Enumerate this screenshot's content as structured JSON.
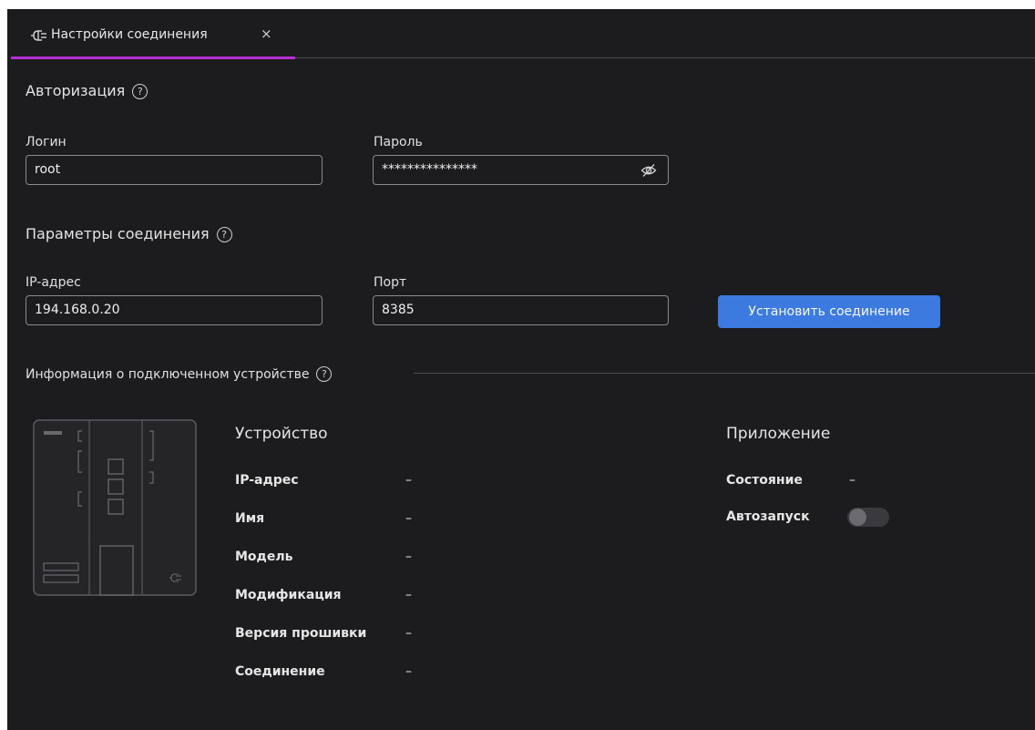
{
  "tab": {
    "icon": "plug-icon",
    "label": "Настройки соединения",
    "close_icon": "close-icon",
    "close_glyph": "×"
  },
  "auth": {
    "title": "Авторизация",
    "login_label": "Логин",
    "login_value": "root",
    "password_label": "Пароль",
    "password_value": "***************",
    "password_icon": "eye-off-icon"
  },
  "connection": {
    "title": "Параметры соединения",
    "ip_label": "IP-адрес",
    "ip_value": "194.168.0.20",
    "port_label": "Порт",
    "port_value": "8385",
    "connect_button": "Установить соединение"
  },
  "info": {
    "title": "Информация о подключенном устройстве",
    "help_glyph": "?",
    "device": {
      "title": "Устройство",
      "rows": [
        {
          "label": "IP-адрес",
          "value": "–"
        },
        {
          "label": "Имя",
          "value": "–"
        },
        {
          "label": "Модель",
          "value": "–"
        },
        {
          "label": "Модификация",
          "value": "–"
        },
        {
          "label": "Версия прошивки",
          "value": "–"
        },
        {
          "label": "Соединение",
          "value": "–"
        }
      ]
    },
    "app": {
      "title": "Приложение",
      "state_label": "Состояние",
      "state_value": "–",
      "autostart_label": "Автозапуск",
      "autostart_on": false
    }
  },
  "colors": {
    "background": "#1c1c1e",
    "accent_tab": "#b62fd6",
    "button": "#3d7ae0"
  }
}
